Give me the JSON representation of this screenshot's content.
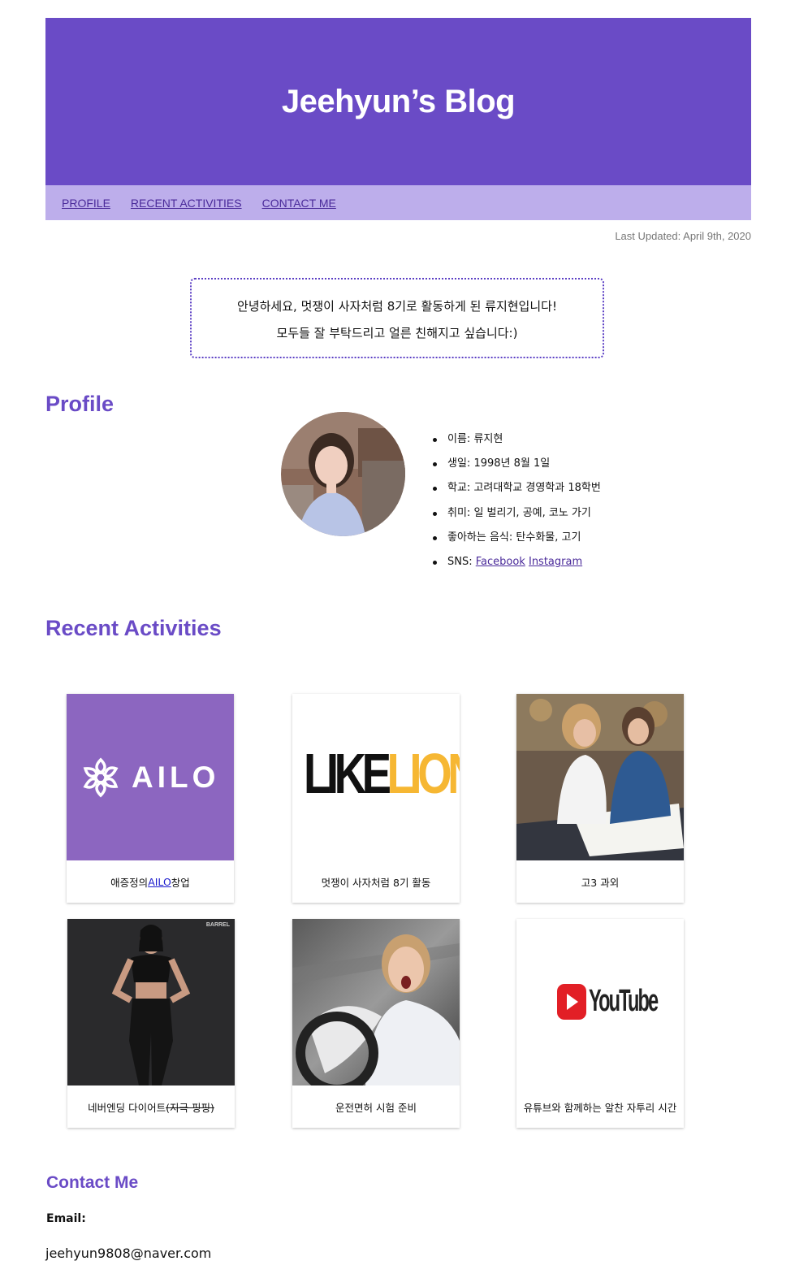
{
  "header": {
    "title": "Jeehyun’s Blog"
  },
  "nav": {
    "profile": "PROFILE",
    "recent": "RECENT ACTIVITIES",
    "contact": "CONTACT ME"
  },
  "last_updated": "Last Updated: April 9th, 2020",
  "greeting": {
    "line1": "안녕하세요, 멋쟁이 사자처럼 8기로 활동하게 된 류지현입니다!",
    "line2": "모두들 잘 부탁드리고 얼른 친해지고 싶습니다:)"
  },
  "profile": {
    "title": "Profile",
    "items": [
      {
        "label": "이름:",
        "value": "류지현"
      },
      {
        "label": "생일:",
        "value": "1998년 8월 1일"
      },
      {
        "label": "학교:",
        "value": "고려대학교 경영학과 18학번"
      },
      {
        "label": "취미:",
        "value": "일 벌리기, 공예, 코노 가기"
      },
      {
        "label": "좋아하는 음식:",
        "value": "탄수화물, 고기"
      }
    ],
    "sns_label": "SNS:",
    "sns_links": [
      "Facebook",
      "Instagram"
    ]
  },
  "recent": {
    "title": "Recent Activities",
    "cards": [
      {
        "caption_pre": "애증정의 ",
        "caption_link": "AILO",
        "caption_post": " 창업",
        "logo_text": "AILO"
      },
      {
        "caption": "멋쟁이 사자처럼 8기 활동",
        "logo_left": "LIKE",
        "logo_right": "LION"
      },
      {
        "caption": "고3 과외"
      },
      {
        "caption_pre": "네버엔딩 다이어트 ",
        "caption_strike": "(지극 핑핑)",
        "badge": "BARREL"
      },
      {
        "caption": "운전면허 시험 준비"
      },
      {
        "caption": "유튜브와 함께하는 알찬 자투리 시간",
        "logo_text": "YouTube"
      }
    ]
  },
  "contact": {
    "title": "Contact Me",
    "email_label": "Email:",
    "email": "jeehyun9808@naver.com"
  },
  "colors": {
    "header": "#6a4bc6",
    "nav": "#bdaeeb",
    "section_title": "#6a4bc6",
    "ailo_bg": "#8c66c0",
    "lion_yellow": "#f6b733",
    "youtube_red": "#e21f26"
  }
}
